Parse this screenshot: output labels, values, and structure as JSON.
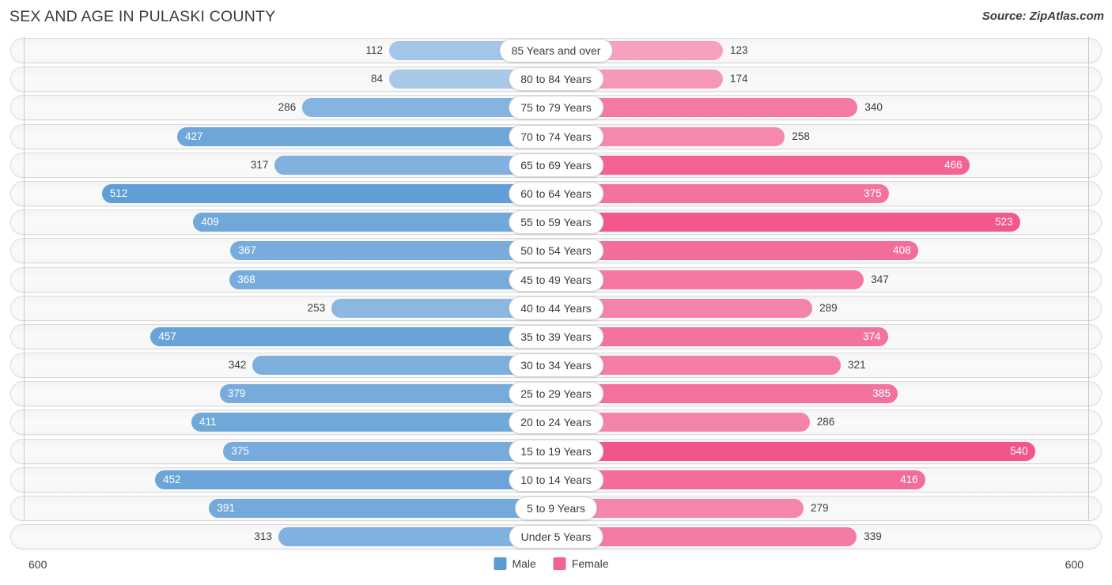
{
  "header": {
    "title": "SEX AND AGE IN PULASKI COUNTY",
    "source": "Source: ZipAtlas.com"
  },
  "axis": {
    "left_label": "600",
    "right_label": "600",
    "max": 600
  },
  "legend": {
    "items": [
      {
        "label": "Male",
        "color": "#5b9bd5"
      },
      {
        "label": "Female",
        "color": "#f2618f"
      }
    ]
  },
  "colors": {
    "male_light": "#a8c8e8",
    "male_dark": "#5b9bd5",
    "female_light": "#f6a8c3",
    "female_dark": "#f2558a",
    "track": "#f7f7f7",
    "gridline": "#c8c8c8",
    "text": "#3c3c3c"
  },
  "chart_data": {
    "type": "bar",
    "title": "SEX AND AGE IN PULASKI COUNTY",
    "subtitle": "",
    "xlabel": "",
    "ylabel": "",
    "orientation": "horizontal-diverging",
    "xlim": [
      -600,
      600
    ],
    "grid": true,
    "legend_position": "bottom-center",
    "categories": [
      "85 Years and over",
      "80 to 84 Years",
      "75 to 79 Years",
      "70 to 74 Years",
      "65 to 69 Years",
      "60 to 64 Years",
      "55 to 59 Years",
      "50 to 54 Years",
      "45 to 49 Years",
      "40 to 44 Years",
      "35 to 39 Years",
      "30 to 34 Years",
      "25 to 29 Years",
      "20 to 24 Years",
      "15 to 19 Years",
      "10 to 14 Years",
      "5 to 9 Years",
      "Under 5 Years"
    ],
    "series": [
      {
        "name": "Male",
        "values": [
          112,
          84,
          286,
          427,
          317,
          512,
          409,
          367,
          368,
          253,
          457,
          342,
          379,
          411,
          375,
          452,
          391,
          313
        ]
      },
      {
        "name": "Female",
        "values": [
          123,
          174,
          340,
          258,
          466,
          375,
          523,
          408,
          347,
          289,
          374,
          321,
          385,
          286,
          540,
          416,
          279,
          339
        ]
      }
    ]
  }
}
